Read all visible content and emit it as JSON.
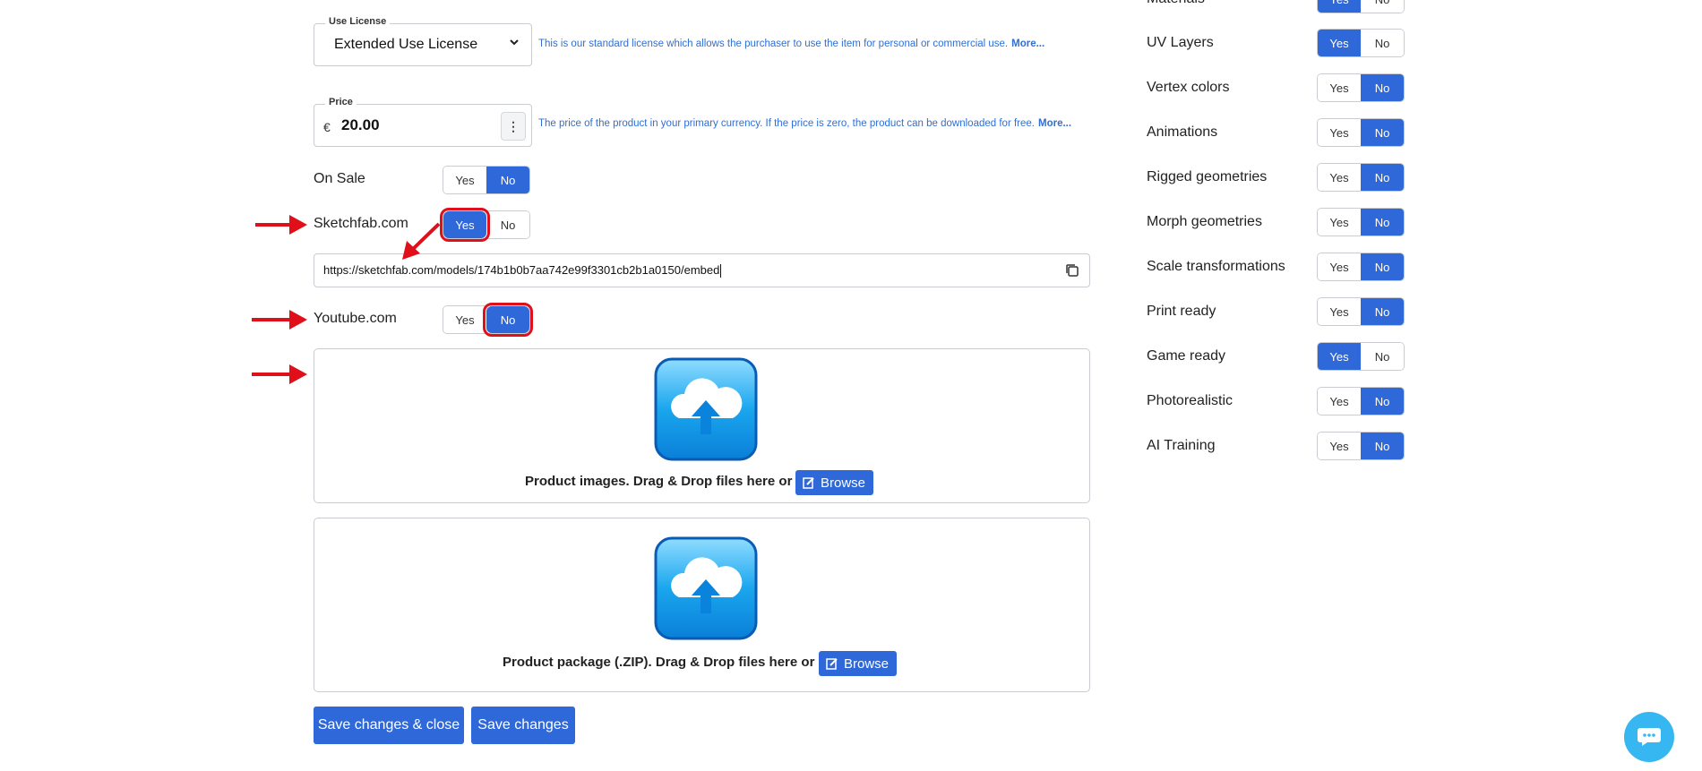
{
  "license": {
    "label": "Use License",
    "value": "Extended Use License",
    "help": "This is our standard license which allows the purchaser to use the item for personal or commercial use.",
    "more": "More..."
  },
  "price": {
    "label": "Price",
    "currency": "€",
    "value": "20.00",
    "help": "The price of the product in your primary currency. If the price is zero, the product can be downloaded for free.",
    "more": "More..."
  },
  "yes_label": "Yes",
  "no_label": "No",
  "left_options": [
    {
      "label": "On Sale",
      "selected": "No"
    },
    {
      "label": "Sketchfab.com",
      "selected": "Yes"
    },
    {
      "label": "Youtube.com",
      "selected": "No"
    }
  ],
  "sketchfab_url": "https://sketchfab.com/models/174b1b0b7aa742e99f3301cb2b1a0150/embed",
  "dropzones": {
    "images_text": "Product images. Drag & Drop files here or",
    "package_text": "Product package (.ZIP). Drag & Drop files here or",
    "browse": "Browse"
  },
  "buttons": {
    "save_close": "Save changes & close",
    "save": "Save changes"
  },
  "right_options": [
    {
      "label": "Materials",
      "selected": "Yes"
    },
    {
      "label": "UV Layers",
      "selected": "Yes"
    },
    {
      "label": "Vertex colors",
      "selected": "No"
    },
    {
      "label": "Animations",
      "selected": "No"
    },
    {
      "label": "Rigged geometries",
      "selected": "No"
    },
    {
      "label": "Morph geometries",
      "selected": "No"
    },
    {
      "label": "Scale transformations",
      "selected": "No"
    },
    {
      "label": "Print ready",
      "selected": "No"
    },
    {
      "label": "Game ready",
      "selected": "Yes"
    },
    {
      "label": "Photorealistic",
      "selected": "No"
    },
    {
      "label": "AI Training",
      "selected": "No"
    }
  ],
  "colors": {
    "accent": "#2f68d9",
    "annotation": "#e0101a",
    "chat": "#36b7f1"
  },
  "icons": [
    "chevron-down-icon",
    "more-vertical-icon",
    "copy-icon",
    "cloud-upload-icon",
    "edit-icon",
    "chat-icon",
    "annotation-arrow-icon"
  ]
}
